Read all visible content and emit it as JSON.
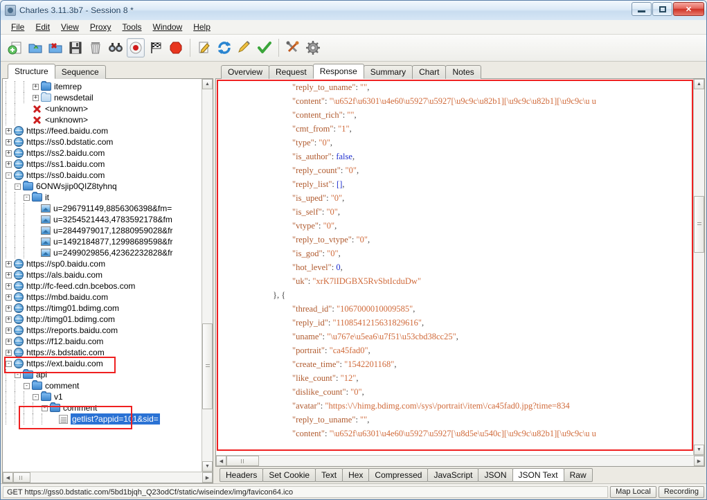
{
  "window": {
    "title": "Charles 3.11.3b7 - Session 8 *",
    "minimize_label": "",
    "maximize_label": "",
    "close_label": "✕"
  },
  "menubar": [
    {
      "label": "File"
    },
    {
      "label": "Edit"
    },
    {
      "label": "View"
    },
    {
      "label": "Proxy"
    },
    {
      "label": "Tools"
    },
    {
      "label": "Window"
    },
    {
      "label": "Help"
    }
  ],
  "toolbar": [
    {
      "name": "new-session-icon",
      "title": "New Session"
    },
    {
      "name": "open-session-icon",
      "title": "Open Session"
    },
    {
      "name": "close-session-icon",
      "title": "Close Session"
    },
    {
      "name": "save-session-icon",
      "title": "Save Session"
    },
    {
      "name": "clear-session-icon",
      "title": "Clear Session"
    },
    {
      "name": "find-icon",
      "title": "Find"
    },
    {
      "name": "record-icon",
      "title": "Start/Stop Recording"
    },
    {
      "name": "throttle-icon",
      "title": "Throttling"
    },
    {
      "name": "breakpoints-icon",
      "title": "Breakpoints"
    },
    {
      "name": "compose-icon",
      "title": "Compose"
    },
    {
      "name": "repeat-icon",
      "title": "Repeat"
    },
    {
      "name": "edit-icon",
      "title": "Edit"
    },
    {
      "name": "validate-icon",
      "title": "Validate"
    },
    {
      "name": "tools-icon",
      "title": "Tools"
    },
    {
      "name": "settings-icon",
      "title": "Settings"
    }
  ],
  "left_tabs": [
    {
      "label": "Structure",
      "active": true
    },
    {
      "label": "Sequence",
      "active": false
    }
  ],
  "right_tabs": [
    {
      "label": "Overview",
      "active": false
    },
    {
      "label": "Request",
      "active": false
    },
    {
      "label": "Response",
      "active": true
    },
    {
      "label": "Summary",
      "active": false
    },
    {
      "label": "Chart",
      "active": false
    },
    {
      "label": "Notes",
      "active": false
    }
  ],
  "bottom_tabs": [
    {
      "label": "Headers",
      "active": false
    },
    {
      "label": "Set Cookie",
      "active": false
    },
    {
      "label": "Text",
      "active": false
    },
    {
      "label": "Hex",
      "active": false
    },
    {
      "label": "Compressed",
      "active": false
    },
    {
      "label": "JavaScript",
      "active": false
    },
    {
      "label": "JSON",
      "active": false
    },
    {
      "label": "JSON Text",
      "active": true
    },
    {
      "label": "Raw",
      "active": false
    }
  ],
  "tree": [
    {
      "label": "itemrep",
      "depth": 3,
      "icon": "folder",
      "expander": "+",
      "partial": true
    },
    {
      "label": "newsdetail",
      "depth": 3,
      "icon": "folderlight",
      "expander": "+"
    },
    {
      "label": "<unknown>",
      "depth": 2,
      "icon": "x",
      "expander": ""
    },
    {
      "label": "<unknown>",
      "depth": 2,
      "icon": "x",
      "expander": ""
    },
    {
      "label": "https://feed.baidu.com",
      "depth": 0,
      "icon": "globe",
      "expander": "+"
    },
    {
      "label": "https://ss0.bdstatic.com",
      "depth": 0,
      "icon": "globe",
      "expander": "+"
    },
    {
      "label": "https://ss2.baidu.com",
      "depth": 0,
      "icon": "globe",
      "expander": "+"
    },
    {
      "label": "https://ss1.baidu.com",
      "depth": 0,
      "icon": "globe",
      "expander": "+"
    },
    {
      "label": "https://ss0.baidu.com",
      "depth": 0,
      "icon": "globe",
      "expander": "-"
    },
    {
      "label": "6ONWsjip0QIZ8tyhnq",
      "depth": 1,
      "icon": "folder",
      "expander": "-"
    },
    {
      "label": "it",
      "depth": 2,
      "icon": "folder",
      "expander": "-"
    },
    {
      "label": "u=296791149,8856306398&fm=",
      "depth": 3,
      "icon": "img",
      "expander": ""
    },
    {
      "label": "u=3254521443,4783592178&fm",
      "depth": 3,
      "icon": "img",
      "expander": ""
    },
    {
      "label": "u=2844979017,12880959028&fr",
      "depth": 3,
      "icon": "img",
      "expander": ""
    },
    {
      "label": "u=1492184877,12998689598&fr",
      "depth": 3,
      "icon": "img",
      "expander": ""
    },
    {
      "label": "u=2499029856,42362232828&fr",
      "depth": 3,
      "icon": "img",
      "expander": ""
    },
    {
      "label": "https://sp0.baidu.com",
      "depth": 0,
      "icon": "globe",
      "expander": "+"
    },
    {
      "label": "https://als.baidu.com",
      "depth": 0,
      "icon": "globe",
      "expander": "+"
    },
    {
      "label": "http://fc-feed.cdn.bcebos.com",
      "depth": 0,
      "icon": "globe",
      "expander": "+"
    },
    {
      "label": "https://mbd.baidu.com",
      "depth": 0,
      "icon": "globe",
      "expander": "+"
    },
    {
      "label": "https://timg01.bdimg.com",
      "depth": 0,
      "icon": "globe",
      "expander": "+"
    },
    {
      "label": "http://timg01.bdimg.com",
      "depth": 0,
      "icon": "globe",
      "expander": "+"
    },
    {
      "label": "https://reports.baidu.com",
      "depth": 0,
      "icon": "globe",
      "expander": "+"
    },
    {
      "label": "https://f12.baidu.com",
      "depth": 0,
      "icon": "globe",
      "expander": "+"
    },
    {
      "label": "https://s.bdstatic.com",
      "depth": 0,
      "icon": "globe",
      "expander": "+"
    },
    {
      "label": "https://ext.baidu.com",
      "depth": 0,
      "icon": "globe",
      "expander": "-",
      "highlight_box": true
    },
    {
      "label": "api",
      "depth": 1,
      "icon": "folder",
      "expander": "-"
    },
    {
      "label": "comment",
      "depth": 2,
      "icon": "folder",
      "expander": "-"
    },
    {
      "label": "v1",
      "depth": 3,
      "icon": "folder",
      "expander": "-"
    },
    {
      "label": "comment",
      "depth": 4,
      "icon": "folder",
      "expander": "-"
    },
    {
      "label": "getlist?appid=101&sid=",
      "depth": 5,
      "icon": "doc",
      "expander": "",
      "selected": true
    }
  ],
  "json_lines": [
    {
      "indent": 7,
      "parts": [
        {
          "t": "\"reply_to_uname\"",
          "c": "k"
        },
        {
          "t": ": ",
          "c": "p"
        },
        {
          "t": "\"\"",
          "c": "s"
        },
        {
          "t": ",",
          "c": "p"
        }
      ]
    },
    {
      "indent": 7,
      "parts": [
        {
          "t": "\"content\"",
          "c": "k"
        },
        {
          "t": ": ",
          "c": "p"
        },
        {
          "t": "\"\\u652f\\u6301\\u4e60\\u5927\\u5927[\\u9c9c\\u82b1][\\u9c9c\\u82b1][\\u9c9c\\u u",
          "c": "s"
        }
      ]
    },
    {
      "indent": 7,
      "parts": [
        {
          "t": "\"content_rich\"",
          "c": "k"
        },
        {
          "t": ": ",
          "c": "p"
        },
        {
          "t": "\"\"",
          "c": "s"
        },
        {
          "t": ",",
          "c": "p"
        }
      ]
    },
    {
      "indent": 7,
      "parts": [
        {
          "t": "\"cmt_from\"",
          "c": "k"
        },
        {
          "t": ": ",
          "c": "p"
        },
        {
          "t": "\"1\"",
          "c": "s"
        },
        {
          "t": ",",
          "c": "p"
        }
      ]
    },
    {
      "indent": 7,
      "parts": [
        {
          "t": "\"type\"",
          "c": "k"
        },
        {
          "t": ": ",
          "c": "p"
        },
        {
          "t": "\"0\"",
          "c": "s"
        },
        {
          "t": ",",
          "c": "p"
        }
      ]
    },
    {
      "indent": 7,
      "parts": [
        {
          "t": "\"is_author\"",
          "c": "k"
        },
        {
          "t": ": ",
          "c": "p"
        },
        {
          "t": "false",
          "c": "n"
        },
        {
          "t": ",",
          "c": "p"
        }
      ]
    },
    {
      "indent": 7,
      "parts": [
        {
          "t": "\"reply_count\"",
          "c": "k"
        },
        {
          "t": ": ",
          "c": "p"
        },
        {
          "t": "\"0\"",
          "c": "s"
        },
        {
          "t": ",",
          "c": "p"
        }
      ]
    },
    {
      "indent": 7,
      "parts": [
        {
          "t": "\"reply_list\"",
          "c": "k"
        },
        {
          "t": ": ",
          "c": "p"
        },
        {
          "t": "[]",
          "c": "n"
        },
        {
          "t": ",",
          "c": "p"
        }
      ]
    },
    {
      "indent": 7,
      "parts": [
        {
          "t": "\"is_uped\"",
          "c": "k"
        },
        {
          "t": ": ",
          "c": "p"
        },
        {
          "t": "\"0\"",
          "c": "s"
        },
        {
          "t": ",",
          "c": "p"
        }
      ]
    },
    {
      "indent": 7,
      "parts": [
        {
          "t": "\"is_self\"",
          "c": "k"
        },
        {
          "t": ": ",
          "c": "p"
        },
        {
          "t": "\"0\"",
          "c": "s"
        },
        {
          "t": ",",
          "c": "p"
        }
      ]
    },
    {
      "indent": 7,
      "parts": [
        {
          "t": "\"vtype\"",
          "c": "k"
        },
        {
          "t": ": ",
          "c": "p"
        },
        {
          "t": "\"0\"",
          "c": "s"
        },
        {
          "t": ",",
          "c": "p"
        }
      ]
    },
    {
      "indent": 7,
      "parts": [
        {
          "t": "\"reply_to_vtype\"",
          "c": "k"
        },
        {
          "t": ": ",
          "c": "p"
        },
        {
          "t": "\"0\"",
          "c": "s"
        },
        {
          "t": ",",
          "c": "p"
        }
      ]
    },
    {
      "indent": 7,
      "parts": [
        {
          "t": "\"is_god\"",
          "c": "k"
        },
        {
          "t": ": ",
          "c": "p"
        },
        {
          "t": "\"0\"",
          "c": "s"
        },
        {
          "t": ",",
          "c": "p"
        }
      ]
    },
    {
      "indent": 7,
      "parts": [
        {
          "t": "\"hot_level\"",
          "c": "k"
        },
        {
          "t": ": ",
          "c": "p"
        },
        {
          "t": "0",
          "c": "n"
        },
        {
          "t": ",",
          "c": "p"
        }
      ]
    },
    {
      "indent": 7,
      "parts": [
        {
          "t": "\"uk\"",
          "c": "k"
        },
        {
          "t": ": ",
          "c": "p"
        },
        {
          "t": "\"xrK7lIDGBX5RvSbtIcduDw\"",
          "c": "s"
        }
      ]
    },
    {
      "indent": 5,
      "parts": [
        {
          "t": "}, {",
          "c": "p"
        }
      ]
    },
    {
      "indent": 7,
      "parts": [
        {
          "t": "\"thread_id\"",
          "c": "k"
        },
        {
          "t": ": ",
          "c": "p"
        },
        {
          "t": "\"1067000010009585\"",
          "c": "s"
        },
        {
          "t": ",",
          "c": "p"
        }
      ]
    },
    {
      "indent": 7,
      "parts": [
        {
          "t": "\"reply_id\"",
          "c": "k"
        },
        {
          "t": ": ",
          "c": "p"
        },
        {
          "t": "\"1108541215631829616\"",
          "c": "s"
        },
        {
          "t": ",",
          "c": "p"
        }
      ]
    },
    {
      "indent": 7,
      "parts": [
        {
          "t": "\"uname\"",
          "c": "k"
        },
        {
          "t": ": ",
          "c": "p"
        },
        {
          "t": "\"\\u767e\\u5ea6\\u7f51\\u53cbd38cc25\"",
          "c": "s"
        },
        {
          "t": ",",
          "c": "p"
        }
      ]
    },
    {
      "indent": 7,
      "parts": [
        {
          "t": "\"portrait\"",
          "c": "k"
        },
        {
          "t": ": ",
          "c": "p"
        },
        {
          "t": "\"ca45fad0\"",
          "c": "s"
        },
        {
          "t": ",",
          "c": "p"
        }
      ]
    },
    {
      "indent": 7,
      "parts": [
        {
          "t": "\"create_time\"",
          "c": "k"
        },
        {
          "t": ": ",
          "c": "p"
        },
        {
          "t": "\"1542201168\"",
          "c": "s"
        },
        {
          "t": ",",
          "c": "p"
        }
      ]
    },
    {
      "indent": 7,
      "parts": [
        {
          "t": "\"like_count\"",
          "c": "k"
        },
        {
          "t": ": ",
          "c": "p"
        },
        {
          "t": "\"12\"",
          "c": "s"
        },
        {
          "t": ",",
          "c": "p"
        }
      ]
    },
    {
      "indent": 7,
      "parts": [
        {
          "t": "\"dislike_count\"",
          "c": "k"
        },
        {
          "t": ": ",
          "c": "p"
        },
        {
          "t": "\"0\"",
          "c": "s"
        },
        {
          "t": ",",
          "c": "p"
        }
      ]
    },
    {
      "indent": 7,
      "parts": [
        {
          "t": "\"avatar\"",
          "c": "k"
        },
        {
          "t": ": ",
          "c": "p"
        },
        {
          "t": "\"https:\\/\\/himg.bdimg.com\\/sys\\/portrait\\/item\\/ca45fad0.jpg?time=834",
          "c": "s"
        }
      ]
    },
    {
      "indent": 7,
      "parts": [
        {
          "t": "\"reply_to_uname\"",
          "c": "k"
        },
        {
          "t": ": ",
          "c": "p"
        },
        {
          "t": "\"\"",
          "c": "s"
        },
        {
          "t": ",",
          "c": "p"
        }
      ]
    },
    {
      "indent": 7,
      "parts": [
        {
          "t": "\"content\"",
          "c": "k"
        },
        {
          "t": ": ",
          "c": "p"
        },
        {
          "t": "\"\\u652f\\u6301\\u4e60\\u5927\\u5927[\\u8d5e\\u540c][\\u9c9c\\u82b1][\\u9c9c\\u u",
          "c": "s"
        }
      ]
    }
  ],
  "statusbar": {
    "text": "GET https://gss0.bdstatic.com/5bd1bjqh_Q23odCf/static/wiseindex/img/favicon64.ico",
    "map_local_label": "Map Local",
    "recording_label": "Recording"
  },
  "colors": {
    "annotation_red": "#ef2020",
    "selection_blue": "#2a72d4",
    "json_key": "#b05a2e",
    "json_string": "#d06a3a",
    "json_literal": "#2030d0"
  }
}
